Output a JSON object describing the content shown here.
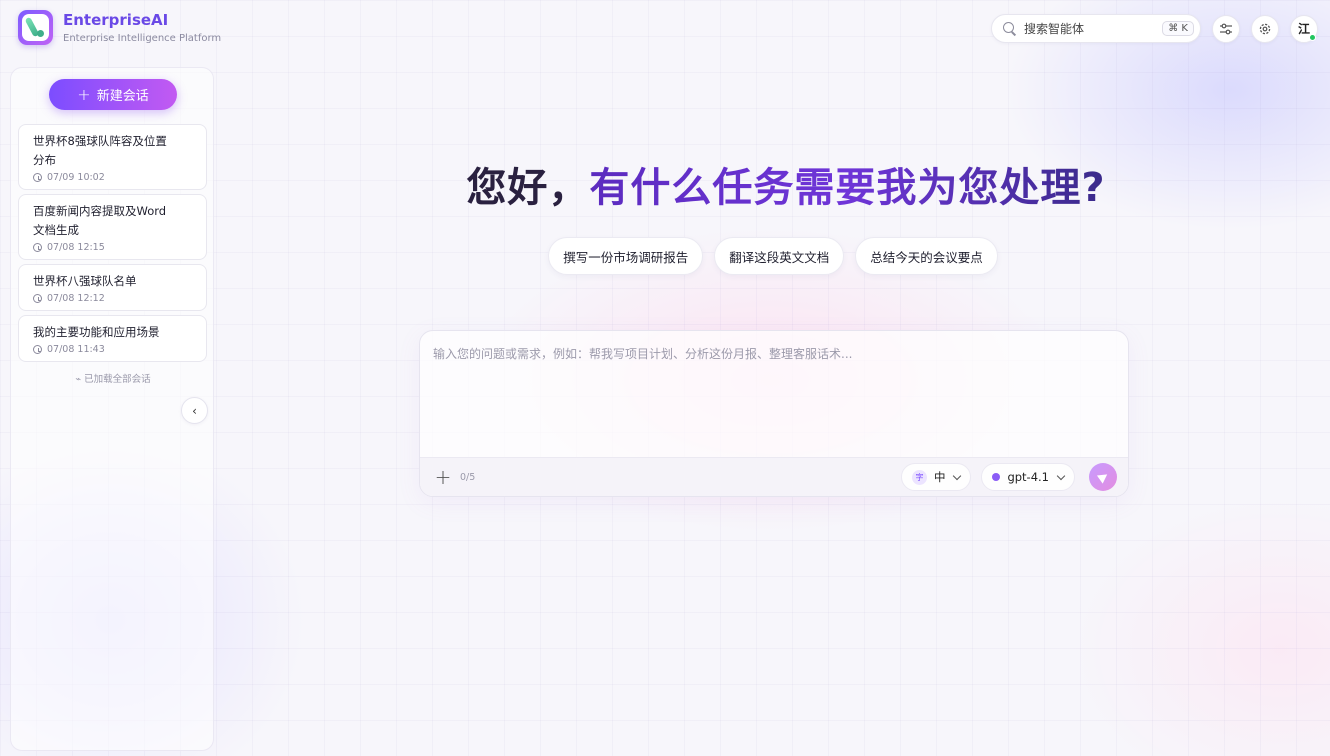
{
  "app": {
    "name": "EnterpriseAI",
    "subtitle": "Enterprise Intelligence Platform"
  },
  "header": {
    "search_placeholder": "搜索智能体",
    "search_shortcut": "⌘ K",
    "avatar_initial": "江"
  },
  "sidebar": {
    "new_chat_label": "新建会话",
    "conversations": [
      {
        "title": "世界杯8强球队阵容及位置分布",
        "time": "07/09 10:02"
      },
      {
        "title": "百度新闻内容提取及Word文档生成",
        "time": "07/08 12:15"
      },
      {
        "title": "世界杯八强球队名单",
        "time": "07/08 12:12"
      },
      {
        "title": "我的主要功能和应用场景",
        "time": "07/08 11:43"
      }
    ],
    "loaded_all_text": "已加载全部会话",
    "collapse_icon": "‹"
  },
  "main": {
    "greeting_dark": "您好，",
    "greeting_gradient": "有什么任务需要我为您处理?",
    "suggestions": [
      "撰写一份市场调研报告",
      "翻译这段英文文档",
      "总结今天的会议要点"
    ],
    "input_placeholder": "输入您的问题或需求，例如：帮我写项目计划、分析这份月报、整理客服话术...",
    "attachment_count": "0/5",
    "language_icon_text": "字",
    "language": "中",
    "model": "gpt-4.1"
  },
  "colors": {
    "accent": "#7c4dff",
    "accent_end": "#c25af2",
    "online": "#22c55e"
  }
}
